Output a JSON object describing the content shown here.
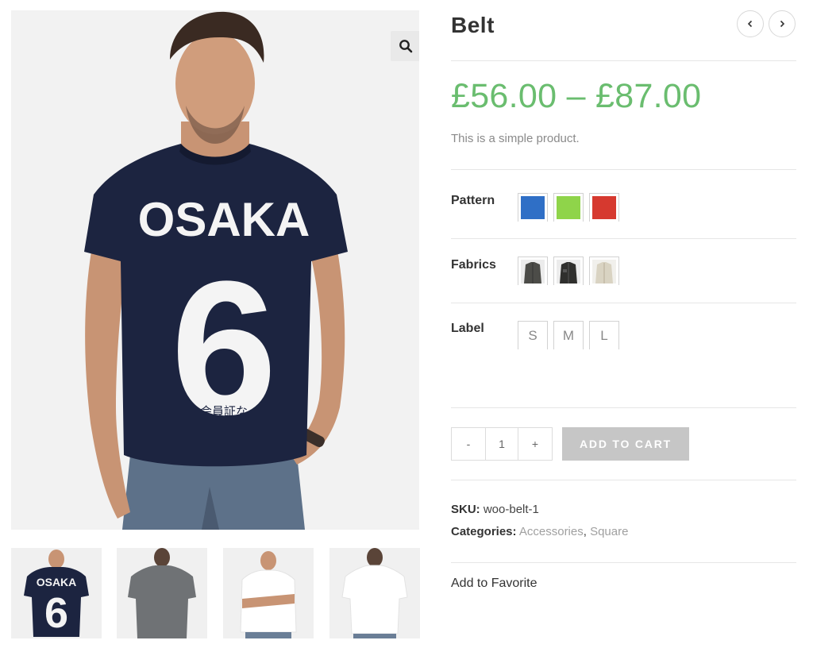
{
  "product": {
    "title": "Belt",
    "price": "£56.00 – £87.00",
    "description": "This is a simple product."
  },
  "gallery": {
    "main_print_top": "OSAKA",
    "main_print_number": "6",
    "main_print_kanji": "会員証な",
    "thumb_print_top": "OSAKA",
    "thumb_print_number": "6",
    "zoom_icon": "search-icon"
  },
  "navigation": {
    "prev_icon": "chevron-left-icon",
    "next_icon": "chevron-right-icon"
  },
  "attributes": {
    "pattern": {
      "label": "Pattern",
      "colors": [
        "#2f6fc6",
        "#8fd44a",
        "#d6392f"
      ]
    },
    "fabrics": {
      "label": "Fabrics"
    },
    "size": {
      "label": "Label",
      "options": [
        "S",
        "M",
        "L"
      ]
    }
  },
  "cart": {
    "minus": "-",
    "quantity": "1",
    "plus": "+",
    "add_to_cart": "ADD TO CART"
  },
  "meta": {
    "sku_label": "SKU:",
    "sku_value": "woo-belt-1",
    "categories_label": "Categories:",
    "categories": [
      "Accessories",
      "Square"
    ],
    "separator": ","
  },
  "favorite": {
    "label": "Add to Favorite"
  },
  "colors": {
    "price": "#6abd6f",
    "cart_button": "#c6c6c6",
    "shirt_navy": "#1c2440"
  }
}
